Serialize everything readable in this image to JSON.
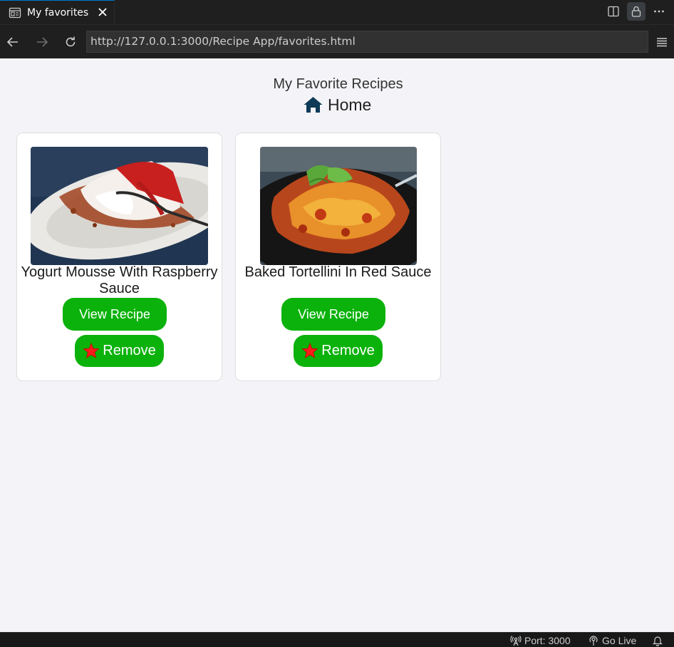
{
  "tab": {
    "title": "My favorites"
  },
  "browser": {
    "url": "http://127.0.0.1:3000/Recipe App/favorites.html"
  },
  "page": {
    "title": "My Favorite Recipes",
    "home_label": "Home"
  },
  "cards": [
    {
      "title": "Yogurt Mousse With Raspberry Sauce",
      "view_label": "View Recipe",
      "remove_label": "Remove",
      "image": "yogurt-mousse-photo"
    },
    {
      "title": "Baked Tortellini In Red Sauce",
      "view_label": "View Recipe",
      "remove_label": "Remove",
      "image": "baked-tortellini-photo"
    }
  ],
  "status": {
    "port_label": "Port: 3000",
    "golive_label": "Go Live"
  },
  "colors": {
    "button_green": "#0bb20b",
    "home_icon": "#0d3a57",
    "star": "#ff1a1a"
  }
}
